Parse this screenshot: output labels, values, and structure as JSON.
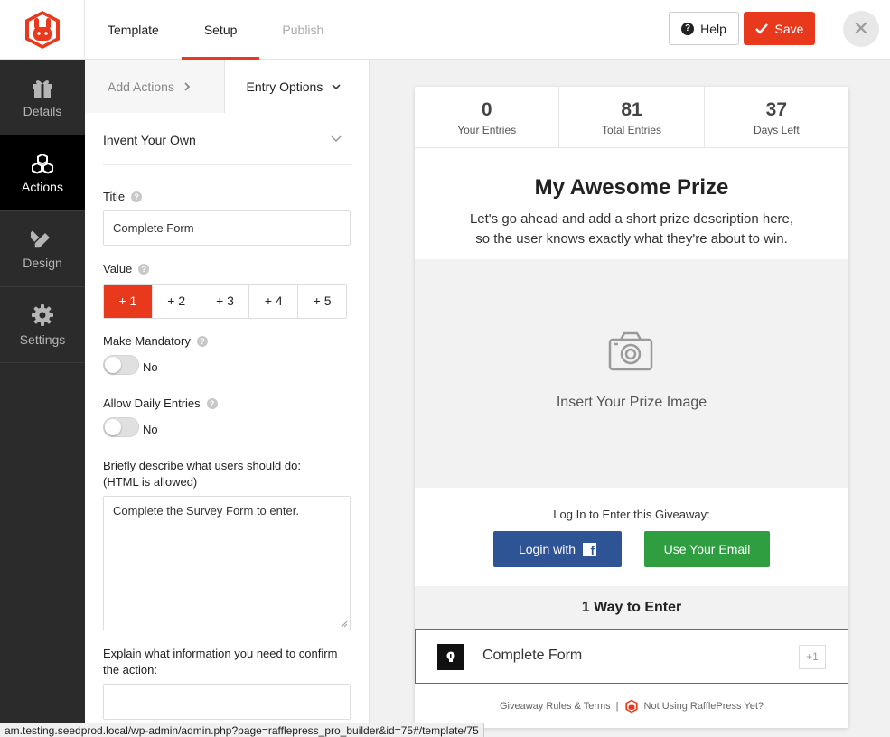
{
  "colors": {
    "accent": "#e8391d",
    "sidebar_bg": "#2b2b2b",
    "facebook": "#2f5496",
    "email": "#2e9e41"
  },
  "header": {
    "logo": "rafflepress-logo",
    "tabs": [
      {
        "label": "Template",
        "state": "normal"
      },
      {
        "label": "Setup",
        "state": "active"
      },
      {
        "label": "Publish",
        "state": "disabled"
      }
    ],
    "help_label": "Help",
    "save_label": "Save",
    "close_label": "✕"
  },
  "sidebar": {
    "items": [
      {
        "label": "Details",
        "icon": "gift-icon"
      },
      {
        "label": "Actions",
        "icon": "cubes-icon",
        "active": true
      },
      {
        "label": "Design",
        "icon": "pencil-ruler-icon"
      },
      {
        "label": "Settings",
        "icon": "gear-icon"
      }
    ]
  },
  "panel": {
    "subtabs": [
      {
        "label": "Add Actions"
      },
      {
        "label": "Entry Options"
      }
    ],
    "section_title": "Invent Your Own",
    "title_label": "Title",
    "title_value": "Complete Form",
    "value_label": "Value",
    "value_options": [
      "+ 1",
      "+ 2",
      "+ 3",
      "+ 4",
      "+ 5"
    ],
    "value_selected": 0,
    "mandatory_label": "Make Mandatory",
    "mandatory_state": "No",
    "daily_label": "Allow Daily Entries",
    "daily_state": "No",
    "describe_label_1": "Briefly describe what users should do:",
    "describe_label_2": "(HTML is allowed)",
    "describe_value": "Complete the Survey Form to enter.",
    "confirm_label_1": "Explain what information you need to confirm",
    "confirm_label_2": "the action:",
    "confirm_value": ""
  },
  "preview": {
    "stats": [
      {
        "value": "0",
        "caption": "Your Entries"
      },
      {
        "value": "81",
        "caption": "Total Entries"
      },
      {
        "value": "37",
        "caption": "Days Left"
      }
    ],
    "prize_title": "My Awesome Prize",
    "prize_desc_1": "Let's go ahead and add a short prize description here,",
    "prize_desc_2": "so the user knows exactly what they're about to win.",
    "image_placeholder": "Insert Your Prize Image",
    "login_prompt": "Log In to Enter this Giveaway:",
    "fb_login_label": "Login with",
    "fb_glyph": "f",
    "email_label": "Use Your Email",
    "ways_to_enter": "1 Way to Enter",
    "entry": {
      "title": "Complete Form",
      "value": "+1"
    },
    "footer_rules": "Giveaway Rules & Terms",
    "footer_sep": "|",
    "footer_promo": "Not Using RafflePress Yet?"
  },
  "status_url": "am.testing.seedprod.local/wp-admin/admin.php?page=rafflepress_pro_builder&id=75#/template/75"
}
